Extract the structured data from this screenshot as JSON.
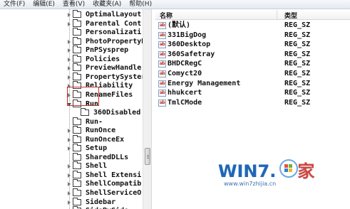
{
  "menu": [
    {
      "label": "文件(F)"
    },
    {
      "label": "编辑(E)"
    },
    {
      "label": "查看(V)"
    },
    {
      "label": "收藏夹(A)"
    },
    {
      "label": "帮助(H)"
    }
  ],
  "tree": {
    "items": [
      {
        "label": "OptimalLayout",
        "expandable": true
      },
      {
        "label": "Parental Cont",
        "expandable": true
      },
      {
        "label": "Personalizati",
        "expandable": false
      },
      {
        "label": "PhotoPropertyH",
        "expandable": true
      },
      {
        "label": "PnPSysprep",
        "expandable": true
      },
      {
        "label": "Policies",
        "expandable": true
      },
      {
        "label": "PreviewHandle",
        "expandable": true
      },
      {
        "label": "PropertySyster",
        "expandable": true
      },
      {
        "label": "Reliability",
        "expandable": true
      },
      {
        "label": "RenameFiles",
        "expandable": true
      },
      {
        "label": "Run",
        "expandable": true,
        "expanded": true,
        "selected": true
      },
      {
        "label": "360Disabled",
        "child": true
      },
      {
        "label": "Run-",
        "expandable": false
      },
      {
        "label": "RunOnce",
        "expandable": true
      },
      {
        "label": "RunOnceEx",
        "expandable": true
      },
      {
        "label": "Setup",
        "expandable": true
      },
      {
        "label": "SharedDLLs",
        "expandable": false
      },
      {
        "label": "Shell",
        "expandable": true
      },
      {
        "label": "Shell Extensi",
        "expandable": true
      },
      {
        "label": "ShellCompatib",
        "expandable": true
      },
      {
        "label": "ShellServiceO",
        "expandable": true
      },
      {
        "label": "Sidebar",
        "expandable": true
      },
      {
        "label": "SideBySide",
        "expandable": true
      }
    ]
  },
  "list": {
    "columns": {
      "name": "名称",
      "type": "类型"
    },
    "icon_text": "ab",
    "rows": [
      {
        "name": "(默认)",
        "type": "REG_SZ"
      },
      {
        "name": "331BigDog",
        "type": "REG_SZ"
      },
      {
        "name": "360Desktop",
        "type": "REG_SZ"
      },
      {
        "name": "360Safetray",
        "type": "REG_SZ"
      },
      {
        "name": "BHDCRegC",
        "type": "REG_SZ"
      },
      {
        "name": "Comyct20",
        "type": "REG_SZ"
      },
      {
        "name": "Energy Management",
        "type": "REG_SZ"
      },
      {
        "name": "hhukcert",
        "type": "REG_SZ"
      },
      {
        "name": "TmlCMode",
        "type": "REG_SZ"
      }
    ]
  },
  "watermark": {
    "logo": "WIN7.",
    "logo_suffix": "家",
    "url": "www.win7zhijia.cn"
  },
  "colors": {
    "highlight_border": "#c8322d",
    "watermark_blue": "#1f66b8"
  }
}
